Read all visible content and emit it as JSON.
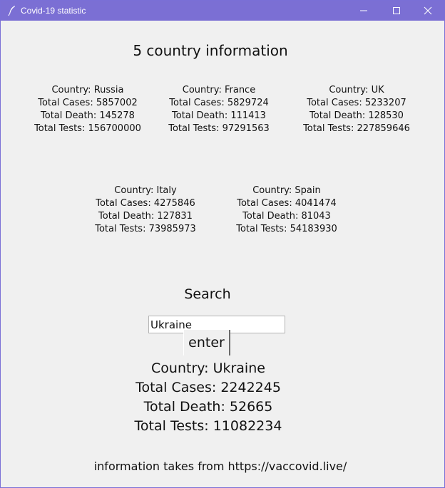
{
  "window": {
    "title": "Covid-19 statistic",
    "titlebar_color": "#7b6fd4",
    "icons": {
      "app": "feather-icon",
      "minimize": "minimize-icon",
      "maximize": "maximize-icon",
      "close": "close-icon"
    }
  },
  "main": {
    "heading": "5 country information",
    "countries": [
      {
        "country": "Country: Russia",
        "cases": "Total Cases: 5857002",
        "death": "Total Death: 145278",
        "tests": "Total Tests: 156700000"
      },
      {
        "country": "Country: France",
        "cases": "Total Cases: 5829724",
        "death": "Total Death: 111413",
        "tests": "Total Tests: 97291563"
      },
      {
        "country": "Country: UK",
        "cases": "Total Cases: 5233207",
        "death": "Total Death: 128530",
        "tests": "Total Tests: 227859646"
      },
      {
        "country": "Country: Italy",
        "cases": "Total Cases: 4275846",
        "death": "Total Death: 127831",
        "tests": "Total Tests: 73985973"
      },
      {
        "country": "Country: Spain",
        "cases": "Total Cases: 4041474",
        "death": "Total Death: 81043",
        "tests": "Total Tests: 54183930"
      }
    ]
  },
  "search": {
    "label": "Search",
    "input_value": "Ukraine",
    "button_label": "enter"
  },
  "result": {
    "country": "Country: Ukraine",
    "cases": "Total Cases: 2242245",
    "death": "Total Death: 52665",
    "tests": "Total Tests: 11082234"
  },
  "footer": {
    "text": "information takes from https://vaccovid.live/"
  }
}
